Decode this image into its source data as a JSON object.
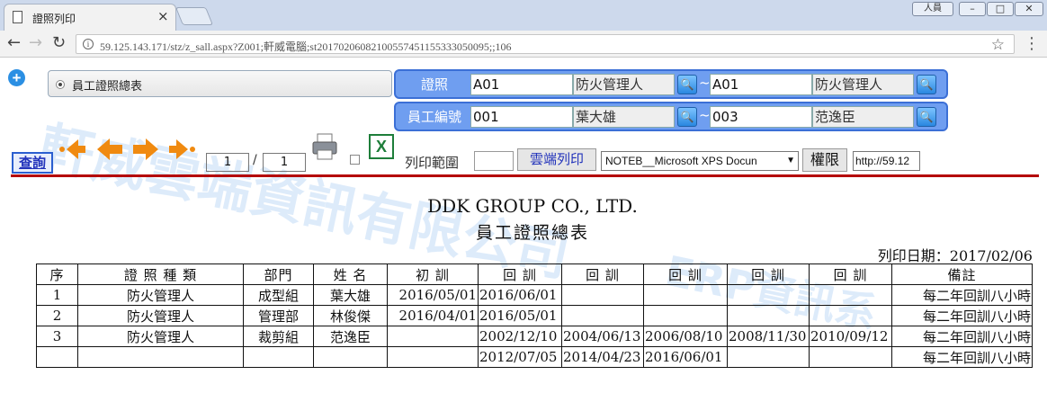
{
  "browser": {
    "tab_title": "證照列印",
    "tab_close": "×",
    "profile": "人員",
    "url": "59.125.143.171/stz/z_sall.aspx?Z001;軒威電腦;st2017020608210055745115533305009​5;;106"
  },
  "watermark": {
    "line1": "軒威雲端資訊有限公司",
    "line2": "ERP資訊系"
  },
  "report_selector": {
    "label": "員工證照總表"
  },
  "criteria": [
    {
      "label": "證照",
      "from_code": "A01",
      "from_name": "防火管理人",
      "to_code": "A01",
      "to_name": "防火管理人"
    },
    {
      "label": "員工編號",
      "from_code": "001",
      "from_name": "葉大雄",
      "to_code": "003",
      "to_name": "范逸臣"
    }
  ],
  "toolbar": {
    "query": "查詢",
    "page_current": "1",
    "page_sep": "/",
    "page_total": "1",
    "range_label": "列印範圍",
    "cloud_print": "雲端列印",
    "printer": "NOTEB__Microsoft XPS Docun",
    "permission": "權限",
    "url_value": "http://59.12"
  },
  "report": {
    "company": "DDK GROUP CO., LTD.",
    "title": "員工證照總表",
    "print_date": "列印日期：2017/02/06",
    "headers": [
      "序",
      "證 照 種 類",
      "部門",
      "姓 名",
      "初 訓",
      "回 訓",
      "回 訓",
      "回 訓",
      "回 訓",
      "回 訓",
      "備註"
    ],
    "rows": [
      [
        "1",
        "防火管理人",
        "成型組",
        "葉大雄",
        "2016/05/01",
        "2016/06/01",
        "",
        "",
        "",
        "",
        "每二年回訓八小時"
      ],
      [
        "2",
        "防火管理人",
        "管理部",
        "林俊傑",
        "2016/04/01",
        "2016/05/01",
        "",
        "",
        "",
        "",
        "每二年回訓八小時"
      ],
      [
        "3",
        "防火管理人",
        "裁剪組",
        "范逸臣",
        "",
        "2002/12/10",
        "2004/06/13",
        "2006/08/10",
        "2008/11/30",
        "2010/09/12",
        "每二年回訓八小時"
      ],
      [
        "",
        "",
        "",
        "",
        "",
        "2012/07/05",
        "2014/04/23",
        "2016/06/01",
        "",
        "",
        "每二年回訓八小時"
      ]
    ]
  },
  "colors": {
    "accent": "#6f9ef0",
    "divider": "#b40000",
    "query_text": "#2233bb"
  }
}
